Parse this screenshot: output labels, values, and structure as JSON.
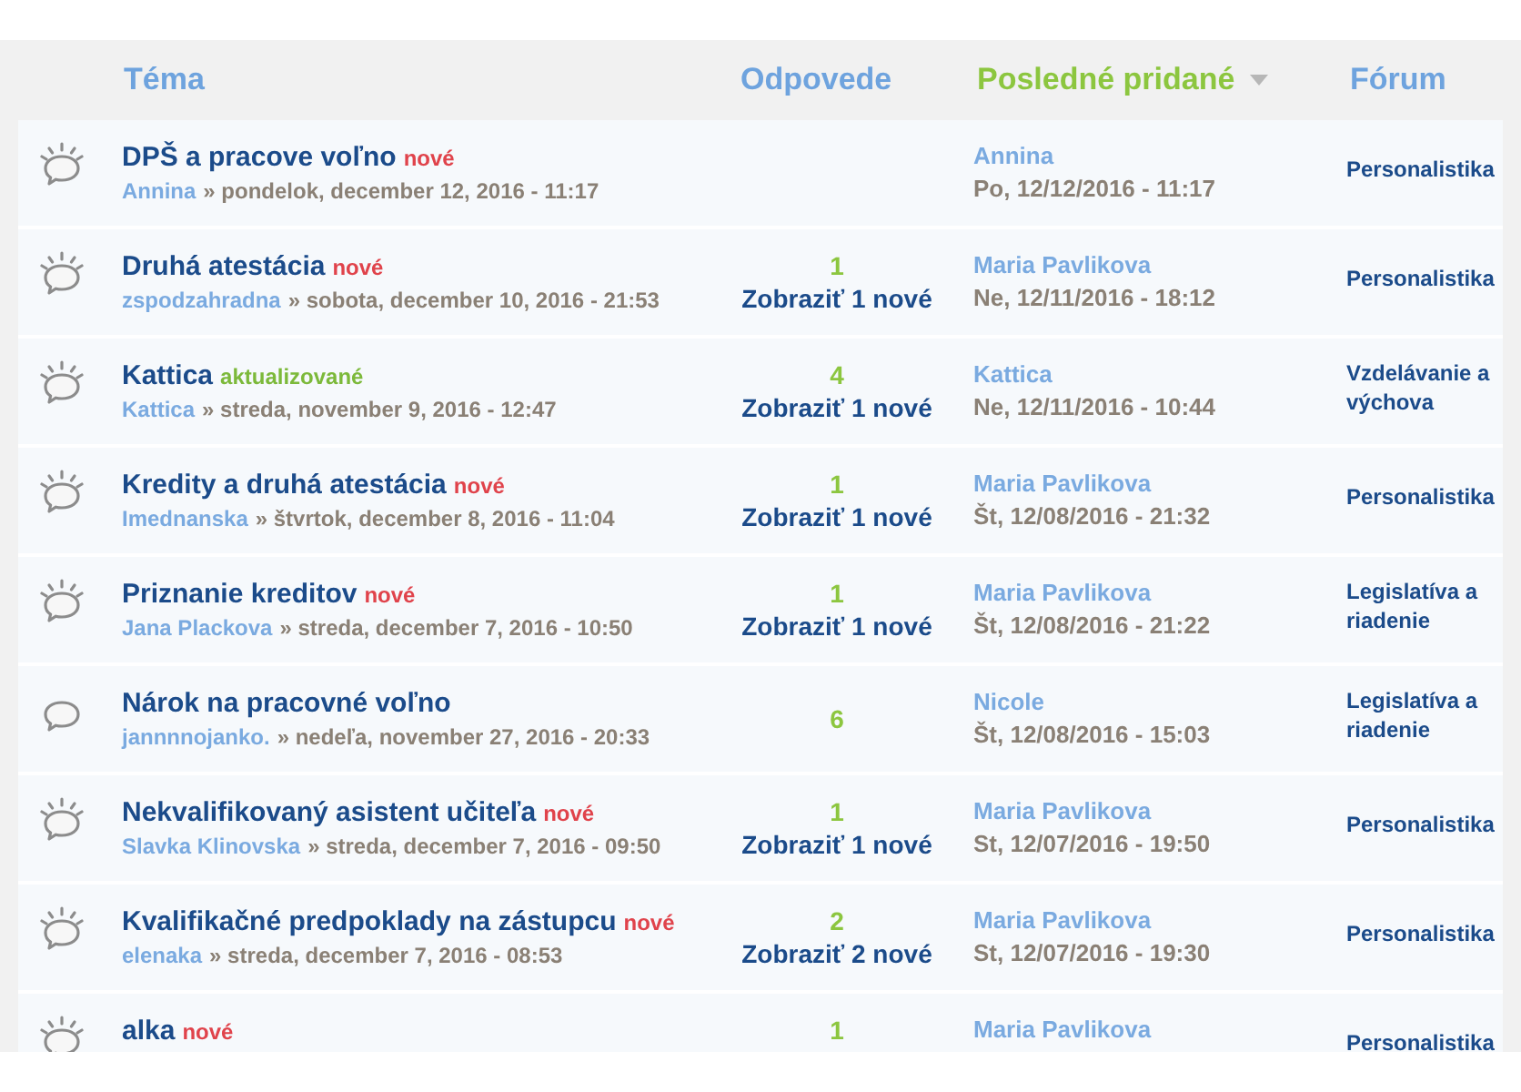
{
  "table": {
    "columns": [
      {
        "label": "Téma",
        "sorted": false
      },
      {
        "label": "Odpovede",
        "sorted": false
      },
      {
        "label": "Posledné pridané",
        "sorted": true
      },
      {
        "label": "Fórum",
        "sorted": false
      }
    ],
    "rows": [
      {
        "new_posts": true,
        "topic": {
          "title": "DPŠ a pracove voľno",
          "badge": {
            "kind": "new",
            "text": "nové"
          },
          "author": "Annina",
          "date": "» pondelok, december 12, 2016 - 11:17"
        },
        "last_post": {
          "author": "Annina",
          "date": "Po, 12/12/2016 - 11:17"
        },
        "forum": "Personalistika"
      },
      {
        "new_posts": true,
        "topic": {
          "title": "Druhá atestácia",
          "badge": {
            "kind": "new",
            "text": "nové"
          },
          "author": "zspodzahradna",
          "date": "» sobota, december 10, 2016 - 21:53"
        },
        "replies": {
          "count": "1",
          "new_link": "Zobraziť 1 nové"
        },
        "last_post": {
          "author": "Maria Pavlikova",
          "date": "Ne, 12/11/2016 - 18:12"
        },
        "forum": "Personalistika"
      },
      {
        "new_posts": true,
        "topic": {
          "title": "Kattica",
          "badge": {
            "kind": "updated",
            "text": "aktualizované"
          },
          "author": "Kattica",
          "date": "» streda, november 9, 2016 - 12:47"
        },
        "replies": {
          "count": "4",
          "new_link": "Zobraziť 1 nové"
        },
        "last_post": {
          "author": "Kattica",
          "date": "Ne, 12/11/2016 - 10:44"
        },
        "forum": "Vzdelávanie a výchova"
      },
      {
        "new_posts": true,
        "topic": {
          "title": "Kredity a druhá atestácia",
          "badge": {
            "kind": "new",
            "text": "nové"
          },
          "author": "Imednanska",
          "date": "» štvrtok, december 8, 2016 - 11:04"
        },
        "replies": {
          "count": "1",
          "new_link": "Zobraziť 1 nové"
        },
        "last_post": {
          "author": "Maria Pavlikova",
          "date": "Št, 12/08/2016 - 21:32"
        },
        "forum": "Personalistika"
      },
      {
        "new_posts": true,
        "topic": {
          "title": "Priznanie kreditov",
          "badge": {
            "kind": "new",
            "text": "nové"
          },
          "author": "Jana Plackova",
          "date": "» streda, december 7, 2016 - 10:50"
        },
        "replies": {
          "count": "1",
          "new_link": "Zobraziť 1 nové"
        },
        "last_post": {
          "author": "Maria Pavlikova",
          "date": "Št, 12/08/2016 - 21:22"
        },
        "forum": "Legislatíva a riadenie"
      },
      {
        "new_posts": false,
        "topic": {
          "title": "Nárok na pracovné voľno",
          "author": "jannnnojanko.",
          "date": "» nedeľa, november 27, 2016 - 20:33"
        },
        "replies": {
          "count": "6"
        },
        "last_post": {
          "author": "Nicole",
          "date": "Št, 12/08/2016 - 15:03"
        },
        "forum": "Legislatíva a riadenie"
      },
      {
        "new_posts": true,
        "topic": {
          "title": "Nekvalifikovaný asistent učiteľa",
          "badge": {
            "kind": "new",
            "text": "nové"
          },
          "author": "Slavka Klinovska",
          "date": "» streda, december 7, 2016 - 09:50"
        },
        "replies": {
          "count": "1",
          "new_link": "Zobraziť 1 nové"
        },
        "last_post": {
          "author": "Maria Pavlikova",
          "date": "St, 12/07/2016 - 19:50"
        },
        "forum": "Personalistika"
      },
      {
        "new_posts": true,
        "topic": {
          "title": "Kvalifikačné predpoklady na zástupcu",
          "badge": {
            "kind": "new",
            "text": "nové"
          },
          "author": "elenaka",
          "date": "» streda, december 7, 2016 - 08:53"
        },
        "replies": {
          "count": "2",
          "new_link": "Zobraziť 2 nové"
        },
        "last_post": {
          "author": "Maria Pavlikova",
          "date": "St, 12/07/2016 - 19:30"
        },
        "forum": "Personalistika"
      },
      {
        "new_posts": true,
        "topic": {
          "title": "alka",
          "badge": {
            "kind": "new",
            "text": "nové"
          }
        },
        "replies": {
          "count": "1"
        },
        "last_post": {
          "author": "Maria Pavlikova"
        },
        "forum": "Personalistika"
      }
    ]
  }
}
